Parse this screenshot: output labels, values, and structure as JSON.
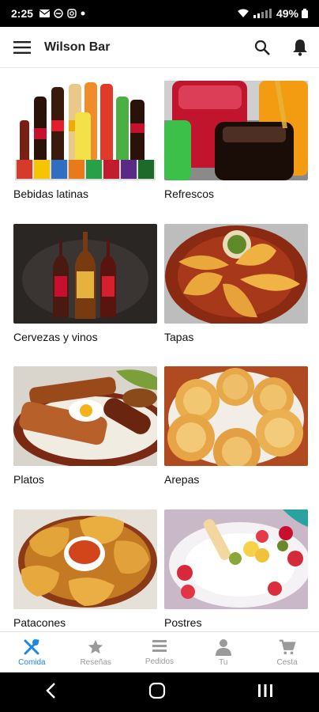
{
  "status": {
    "time": "2:25",
    "battery": "49%"
  },
  "appbar": {
    "title": "Wilson Bar"
  },
  "categories": [
    {
      "label": "Bebidas latinas"
    },
    {
      "label": "Refrescos"
    },
    {
      "label": "Cervezas y vinos"
    },
    {
      "label": "Tapas"
    },
    {
      "label": "Platos"
    },
    {
      "label": "Arepas"
    },
    {
      "label": "Patacones"
    },
    {
      "label": "Postres"
    }
  ],
  "bottom_nav": [
    {
      "label": "Comida",
      "icon": "fork-knife-icon",
      "active": true
    },
    {
      "label": "Reseñas",
      "icon": "star-icon",
      "active": false
    },
    {
      "label": "Pedidos",
      "icon": "list-icon",
      "active": false
    },
    {
      "label": "Tu",
      "icon": "person-icon",
      "active": false
    },
    {
      "label": "Cesta",
      "icon": "cart-icon",
      "active": false
    }
  ],
  "colors": {
    "accent": "#1e88e5",
    "inactive": "#9a9a9a"
  }
}
